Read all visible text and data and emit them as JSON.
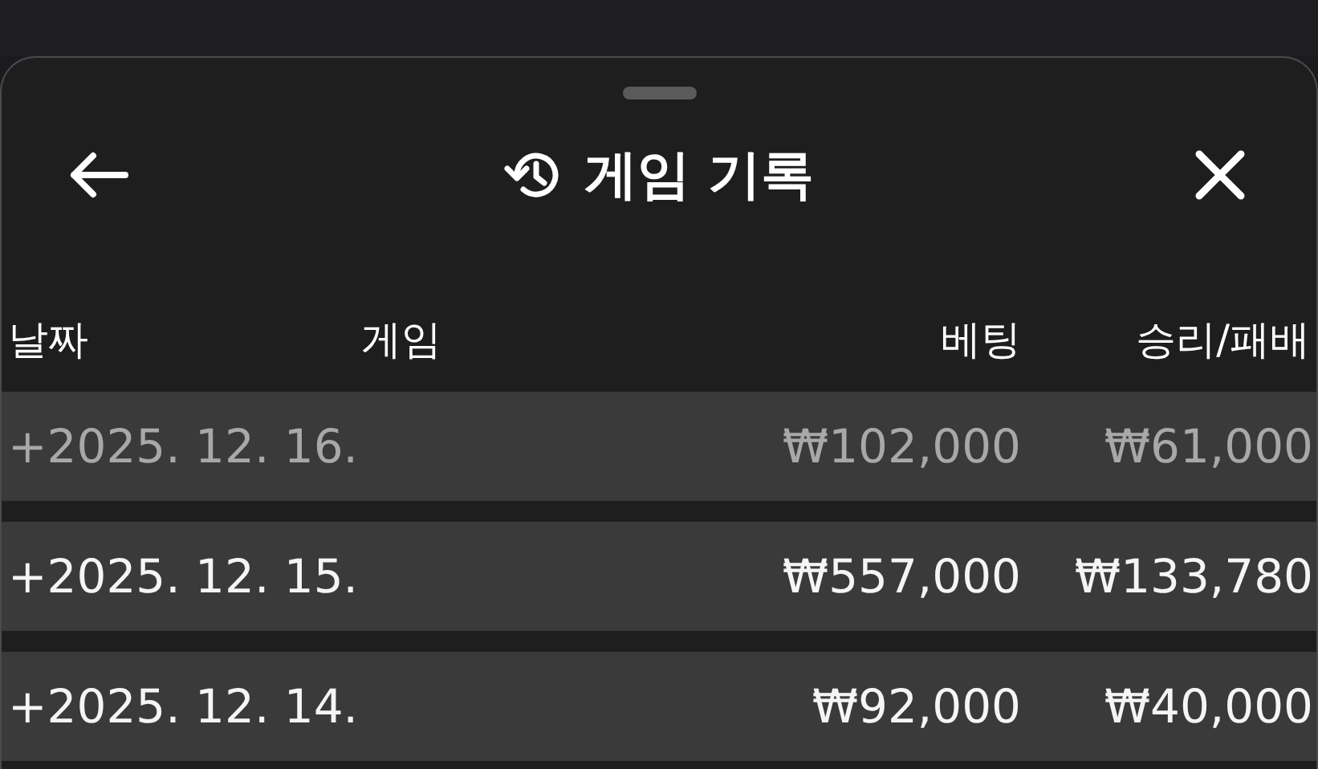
{
  "sheet": {
    "title": "게임 기록"
  },
  "columns": [
    {
      "label": "날짜"
    },
    {
      "label": "게임"
    },
    {
      "label": "베팅"
    },
    {
      "label": "승리/패배"
    }
  ],
  "rows": [
    {
      "date": "+2025. 12. 16.",
      "bet": "₩102,000",
      "result": "₩61,000",
      "disabled": true
    },
    {
      "date": "+2025. 12. 15.",
      "bet": "₩557,000",
      "result": "₩133,780",
      "disabled": false
    },
    {
      "date": "+2025. 12. 14.",
      "bet": "₩92,000",
      "result": "₩40,000",
      "disabled": false
    }
  ]
}
